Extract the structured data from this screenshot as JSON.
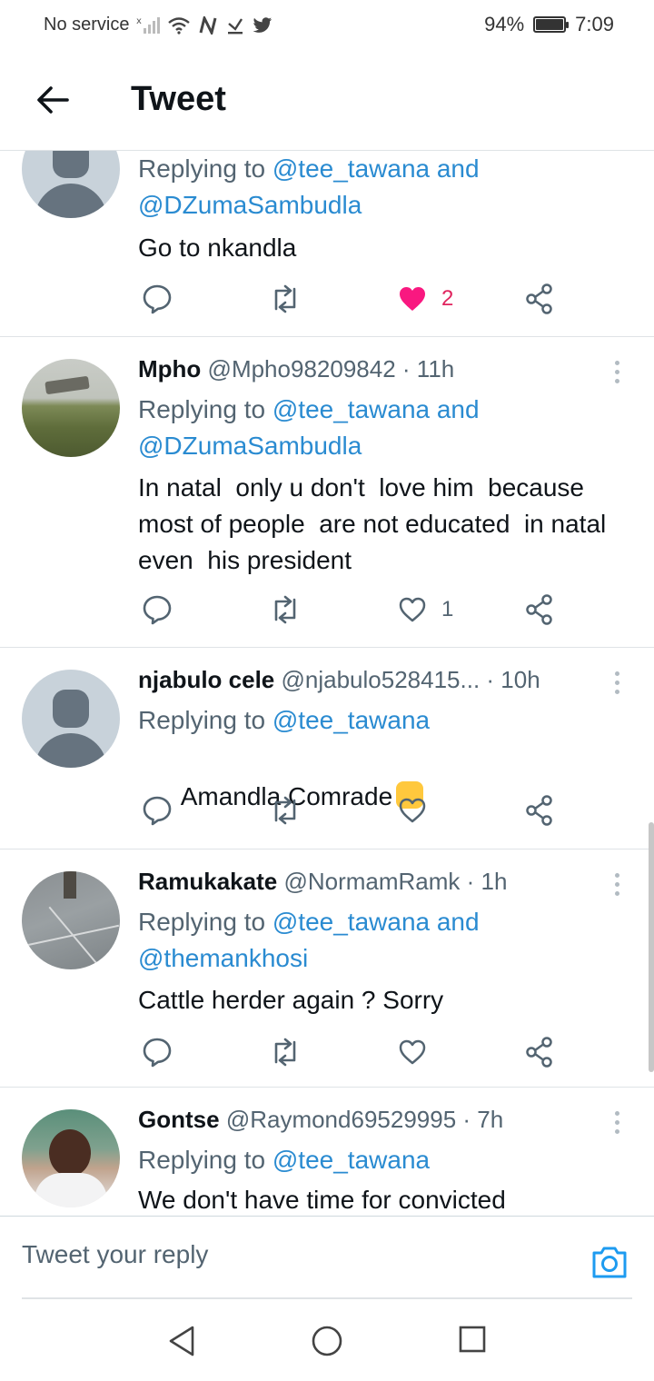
{
  "status_bar": {
    "carrier": "No service",
    "battery": "94%",
    "battery_level": 0.94,
    "time": "7:09",
    "icons": [
      "signal-icon",
      "wifi-icon",
      "nfc-icon",
      "download-icon",
      "twitter-icon"
    ]
  },
  "header": {
    "title": "Tweet"
  },
  "tweets": [
    {
      "name": "",
      "handle": "",
      "time": "",
      "replying_prefix": "Replying to",
      "replying_to": "@tee_tawana and @DZumaSambudla",
      "text": "Go to nkandla",
      "likes": "2",
      "liked": true
    },
    {
      "name": "Mpho",
      "handle": "@Mpho98209842",
      "time": "· 11h",
      "replying_prefix": "Replying to",
      "replying_to": "@tee_tawana and @DZumaSambudla",
      "text": "In natal  only u don't  love him  because most of people  are not educated  in natal even  his president",
      "likes": "1",
      "liked": false
    },
    {
      "name": "njabulo cele",
      "handle": "@njabulo528415...",
      "time": "· 10h",
      "replying_prefix": "Replying to",
      "replying_to": "@tee_tawana",
      "text": "Amandla Comrade",
      "likes": "",
      "liked": false
    },
    {
      "name": "Ramukakate",
      "handle": "@NormamRamk",
      "time": "· 1h",
      "replying_prefix": "Replying to",
      "replying_to": "@tee_tawana and @themankhosi",
      "text": "Cattle herder again ? Sorry",
      "likes": "",
      "liked": false
    },
    {
      "name": "Gontse",
      "handle": "@Raymond69529995",
      "time": "· 7h",
      "replying_prefix": "Replying to",
      "replying_to": "@tee_tawana",
      "text": "We don't have time for convicted",
      "likes": "",
      "liked": false
    }
  ],
  "reply_bar": {
    "placeholder": "Tweet your reply"
  },
  "colors": {
    "mention": "#2a8bd1",
    "like": "#e0245e",
    "text": "#0f1419",
    "muted": "#536471"
  }
}
